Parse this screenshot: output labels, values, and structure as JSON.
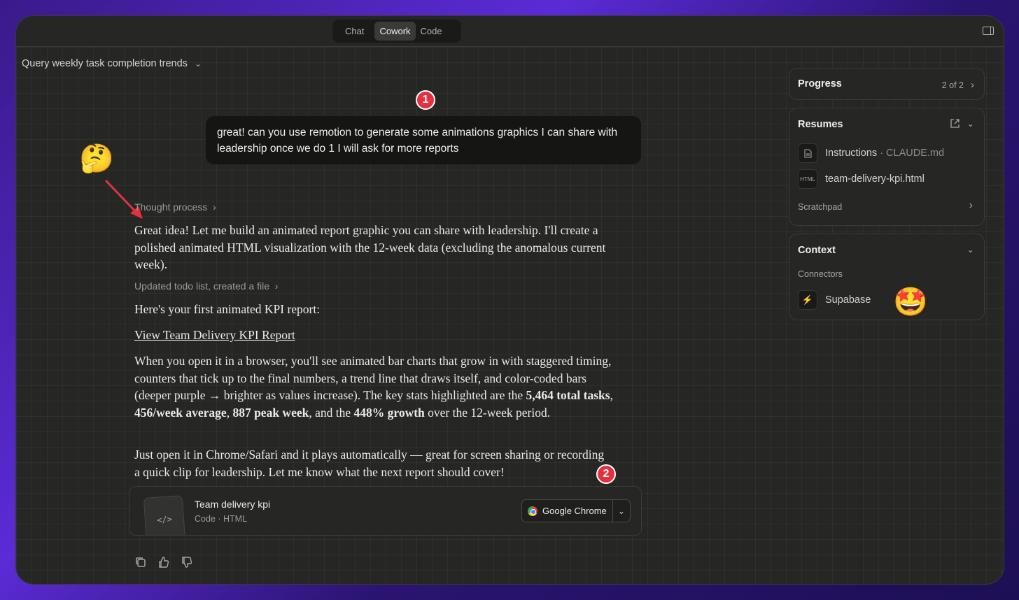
{
  "titlebar": {
    "modes": [
      "Chat",
      "Cowork",
      "Code"
    ],
    "active_mode": "Cowork"
  },
  "conversation": {
    "title": "Query weekly task completion trends",
    "user_message": "great! can you use remotion to generate some animations graphics I can share with leadership once we do 1 I will ask for more reports",
    "thought_process": "Thought process",
    "response_intro": "Great idea! Let me build an animated report graphic you can share with leadership. I'll create a polished animated HTML visualization with the 12-week data (excluding the anomalous current week).",
    "todo_update": "Updated todo list, created a file",
    "first_report": "Here's your first animated KPI report:",
    "report_link": "View Team Delivery KPI Report",
    "details": {
      "p1": "When you open it in a browser, you'll see animated bar charts that grow in with staggered timing, counters that tick up to the final numbers, a trend line that draws itself, and color-coded bars (deeper purple → brighter as values increase). The key stats highlighted are the ",
      "stat1": "5,464 total tasks",
      "sep1": ", ",
      "stat2": "456/week average",
      "sep2": ", ",
      "stat3": "887 peak week",
      "sep3": ", and the ",
      "stat4": "448% growth",
      "p1_end": " over the 12-week period."
    },
    "closing": "Just open it in Chrome/Safari and it plays automatically — great for screen sharing or recording a quick clip for leadership. Let me know what the next report should cover!",
    "artifact": {
      "icon_text": "</>",
      "title": "Team delivery kpi",
      "subtitle": "Code · HTML",
      "open_with": "Google Chrome"
    }
  },
  "annotations": {
    "marker1": "1",
    "marker2": "2"
  },
  "right_panel": {
    "progress": {
      "title": "Progress",
      "count": "2 of 2"
    },
    "resumes": {
      "title": "Resumes",
      "files": [
        {
          "name": "Instructions",
          "meta": "· CLAUDE.md",
          "icon": "doc-icon"
        },
        {
          "name": "team-delivery-kpi.html",
          "meta": "",
          "icon": "html-file-icon",
          "badge": "HTML"
        }
      ],
      "scratchpad": "Scratchpad"
    },
    "context": {
      "title": "Context",
      "connectors_label": "Connectors",
      "connector": "Supabase"
    }
  },
  "colors": {
    "window_bg": "#262624",
    "marker_red": "#e4313f",
    "supabase_green": "#3ecf8e"
  }
}
